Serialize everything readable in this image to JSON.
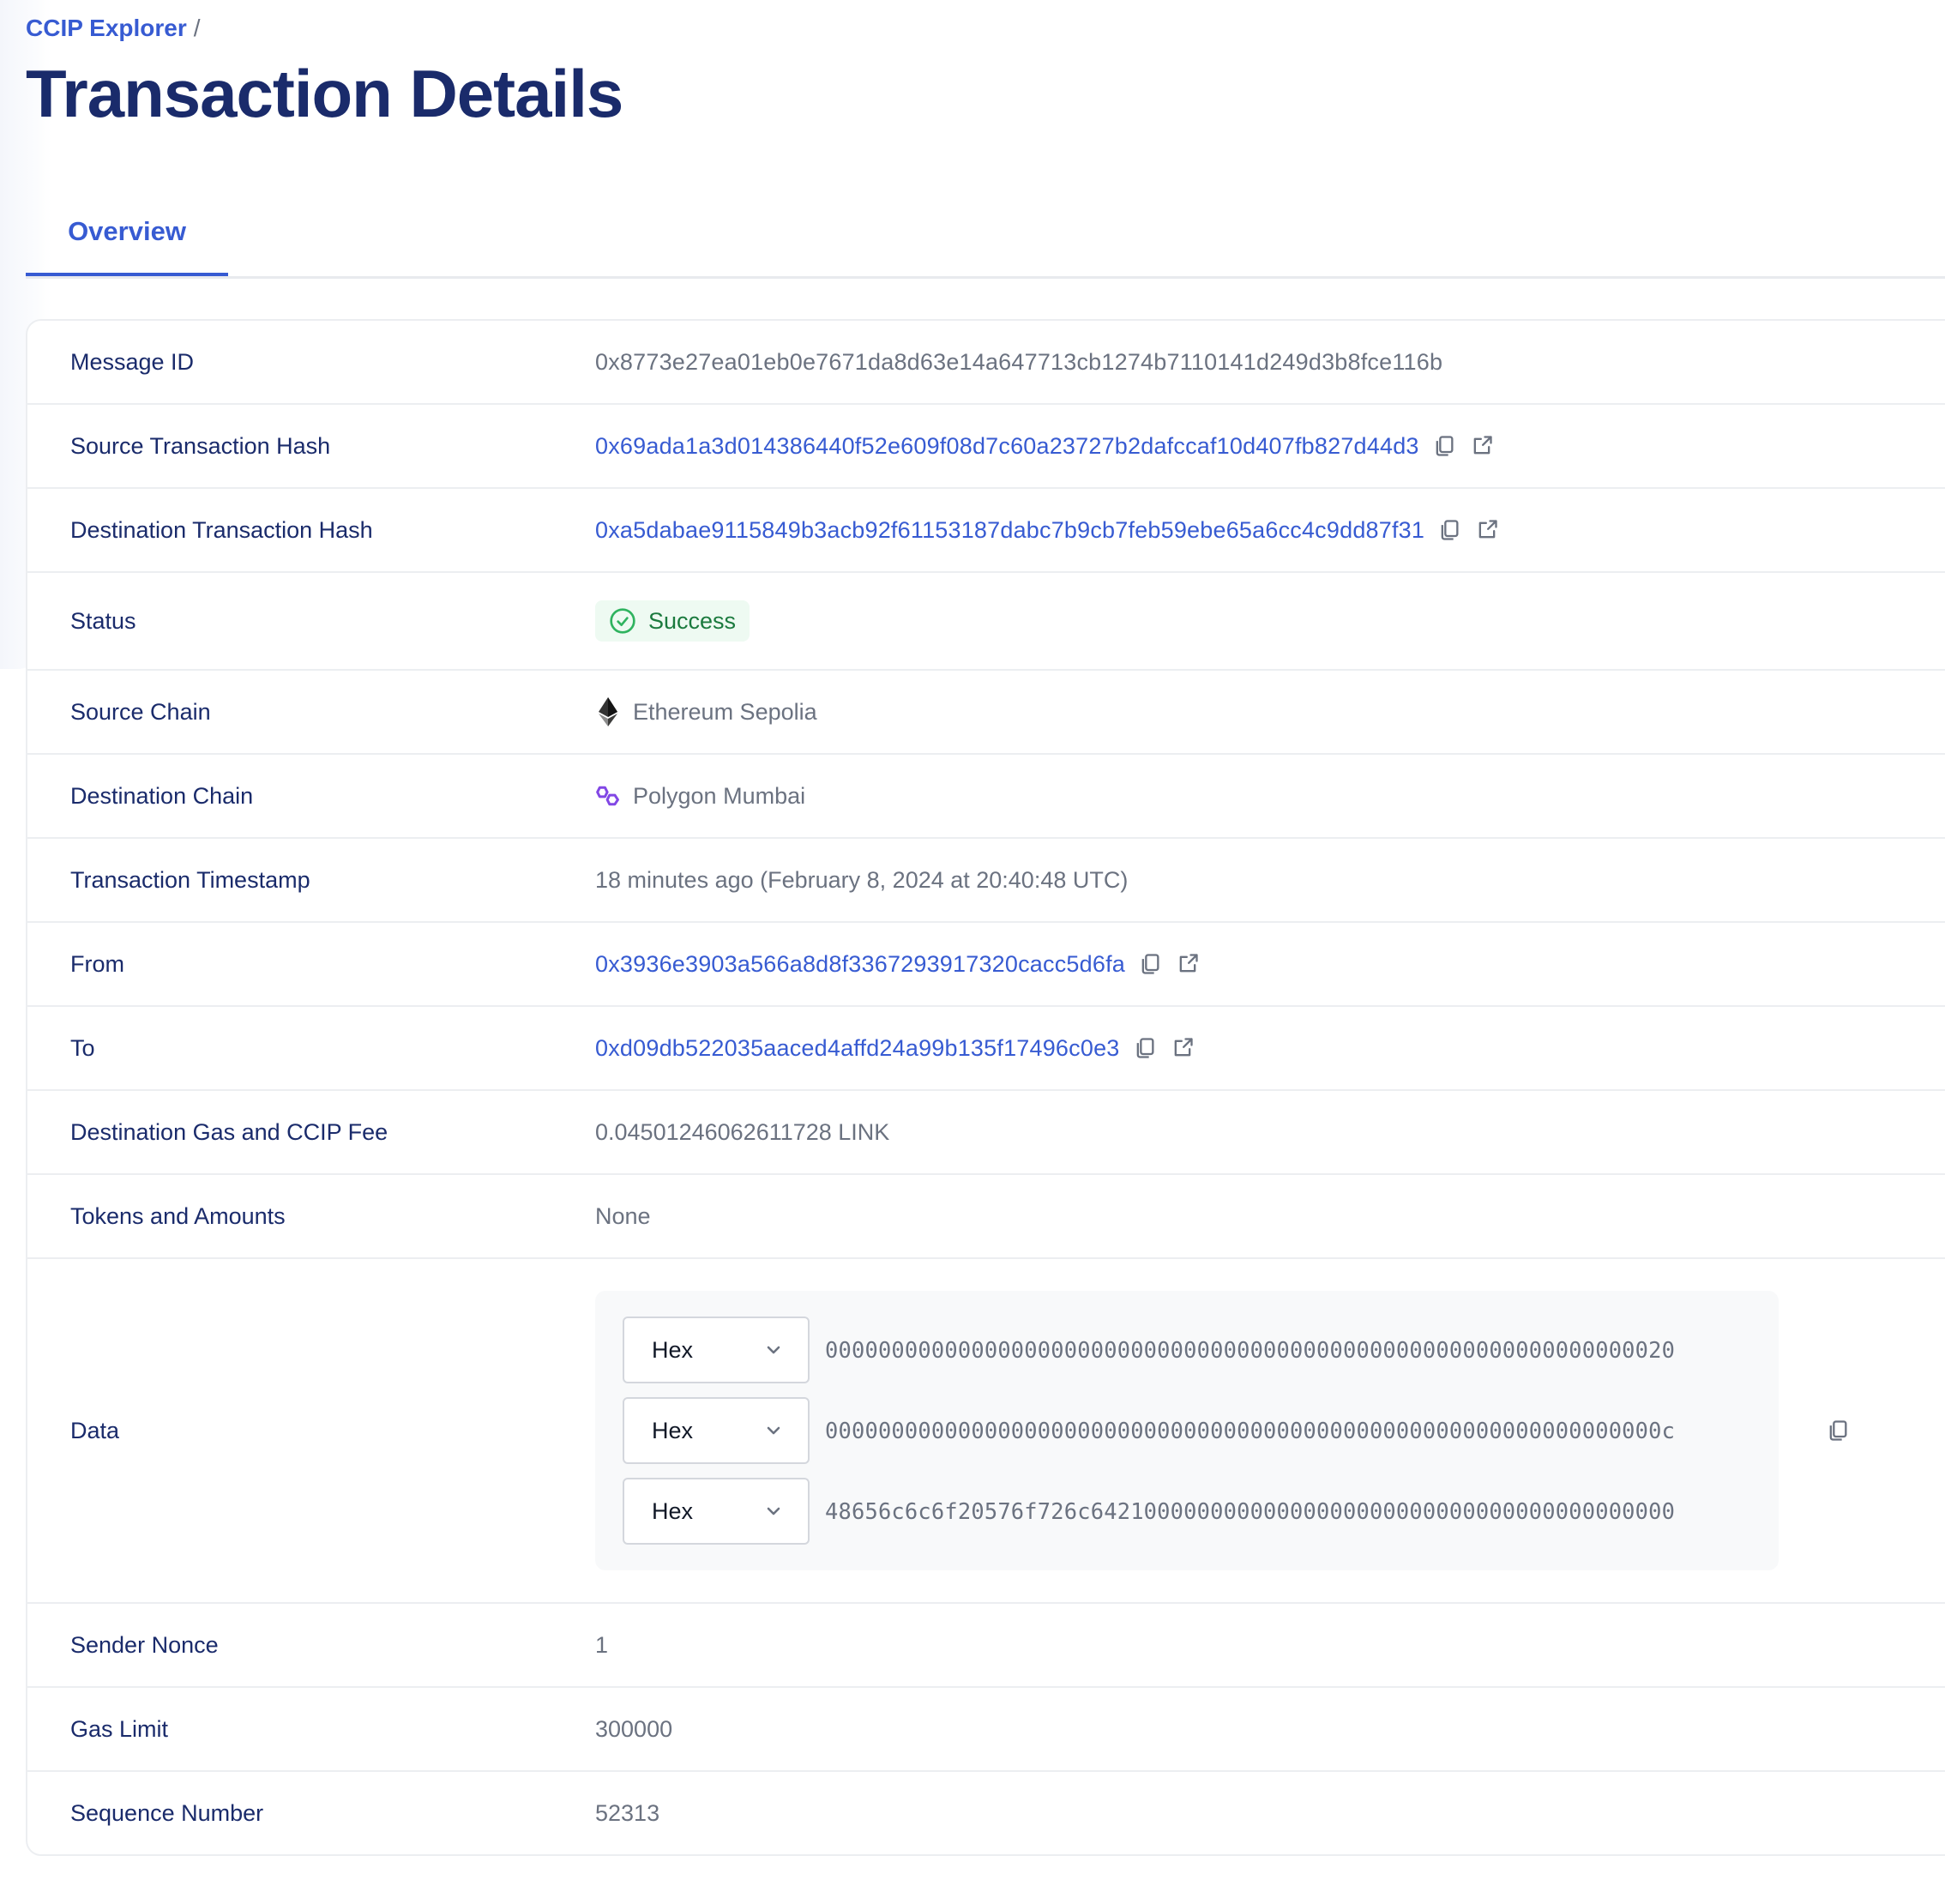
{
  "breadcrumb": {
    "root": "CCIP Explorer",
    "separator": "/"
  },
  "page_title": "Transaction Details",
  "tabs": [
    {
      "label": "Overview",
      "active": true
    }
  ],
  "colors": {
    "accent": "#375bd2",
    "title": "#1a2b6b",
    "success": "#1b7a3e",
    "success_bg": "#eefaf2",
    "polygon": "#8247e5"
  },
  "details": {
    "message_id": {
      "label": "Message ID",
      "value": "0x8773e27ea01eb0e7671da8d63e14a647713cb1274b7110141d249d3b8fce116b"
    },
    "source_tx_hash": {
      "label": "Source Transaction Hash",
      "value": "0x69ada1a3d014386440f52e609f08d7c60a23727b2dafccaf10d407fb827d44d3"
    },
    "destination_tx_hash": {
      "label": "Destination Transaction Hash",
      "value": "0xa5dabae9115849b3acb92f61153187dabc7b9cb7feb59ebe65a6cc4c9dd87f31"
    },
    "status": {
      "label": "Status",
      "value": "Success",
      "icon": "check-circle-icon"
    },
    "source_chain": {
      "label": "Source Chain",
      "value": "Ethereum Sepolia",
      "icon": "ethereum-icon"
    },
    "destination_chain": {
      "label": "Destination Chain",
      "value": "Polygon Mumbai",
      "icon": "polygon-icon"
    },
    "timestamp": {
      "label": "Transaction Timestamp",
      "value": "18 minutes ago (February 8, 2024 at 20:40:48 UTC)"
    },
    "from": {
      "label": "From",
      "value": "0x3936e3903a566a8d8f3367293917320cacc5d6fa"
    },
    "to": {
      "label": "To",
      "value": "0xd09db522035aaced4affd24a99b135f17496c0e3"
    },
    "fee": {
      "label": "Destination Gas and CCIP Fee",
      "value": "0.04501246062611728 LINK"
    },
    "tokens": {
      "label": "Tokens and Amounts",
      "value": "None"
    },
    "data": {
      "label": "Data",
      "lines": [
        {
          "format": "Hex",
          "value": "0000000000000000000000000000000000000000000000000000000000000020"
        },
        {
          "format": "Hex",
          "value": "000000000000000000000000000000000000000000000000000000000000000c"
        },
        {
          "format": "Hex",
          "value": "48656c6c6f20576f726c64210000000000000000000000000000000000000000"
        }
      ]
    },
    "sender_nonce": {
      "label": "Sender Nonce",
      "value": "1"
    },
    "gas_limit": {
      "label": "Gas Limit",
      "value": "300000"
    },
    "sequence_number": {
      "label": "Sequence Number",
      "value": "52313"
    }
  }
}
